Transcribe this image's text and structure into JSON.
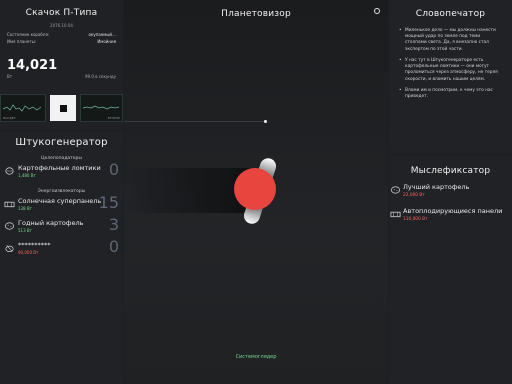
{
  "ship": {
    "title": "Скачок П-Типа",
    "date": "2076.10.04",
    "state_label": "Состояние корабля:",
    "state_value": "окупаемый…",
    "planet_label": "Имя планеты:",
    "planet_value": "Имойния",
    "money": "14,021",
    "money_unit": "Вт",
    "progress_text": "99.0 в секунду"
  },
  "strip": {
    "left_label": "ВАНДЕР",
    "right_label": "ВТОРОЕ"
  },
  "generator": {
    "title": "Штукогенератор",
    "categories": [
      {
        "name": "Целепопадаторы",
        "items": [
          {
            "name": "Картофельные ломтики",
            "power": "1,480 Вт",
            "count": "0",
            "status": "green",
            "icon": "potato-slice-icon"
          }
        ]
      },
      {
        "name": "Энергоизвлекаторы",
        "items": [
          {
            "name": "Солнечная суперпанель",
            "power": "138 Вт",
            "count": "15",
            "status": "green",
            "icon": "solar-panel-icon"
          },
          {
            "name": "Годный картофель",
            "power": "513 Вт",
            "count": "3",
            "status": "green",
            "icon": "potato-icon"
          },
          {
            "name": "**********",
            "power": "90,000 Вт",
            "count": "0",
            "status": "red",
            "icon": "locked-icon"
          }
        ]
      }
    ]
  },
  "viewer": {
    "title": "Планетовизор",
    "system_label": "Системоглядер"
  },
  "printer": {
    "title": "Словопечатор",
    "paragraphs": [
      "Миленькое дело — мы должны нанести мощный удар по земле под теми столпами света. Да, я внезапно стал экспертом по этой части.",
      "У нас тут в Штукогенераторе есть картофельные ломтики — они могут проломиться через атмосферу, не теряя скорости, и вломить нашим целям.",
      "Вломи им и посмотрим, к чему это нас приведет."
    ]
  },
  "thinker": {
    "title": "Мыслефиксатор",
    "items": [
      {
        "name": "Лучший картофель",
        "power": "22,000 Вт",
        "status": "red",
        "icon": "potato-icon"
      },
      {
        "name": "Автоплодирующиеся панели",
        "power": "110,000 Вт",
        "status": "red",
        "icon": "solar-panel-icon"
      }
    ]
  },
  "colors": {
    "accent_green": "#7bd88f",
    "accent_red": "#ff6464",
    "planet": "#e8453f"
  }
}
